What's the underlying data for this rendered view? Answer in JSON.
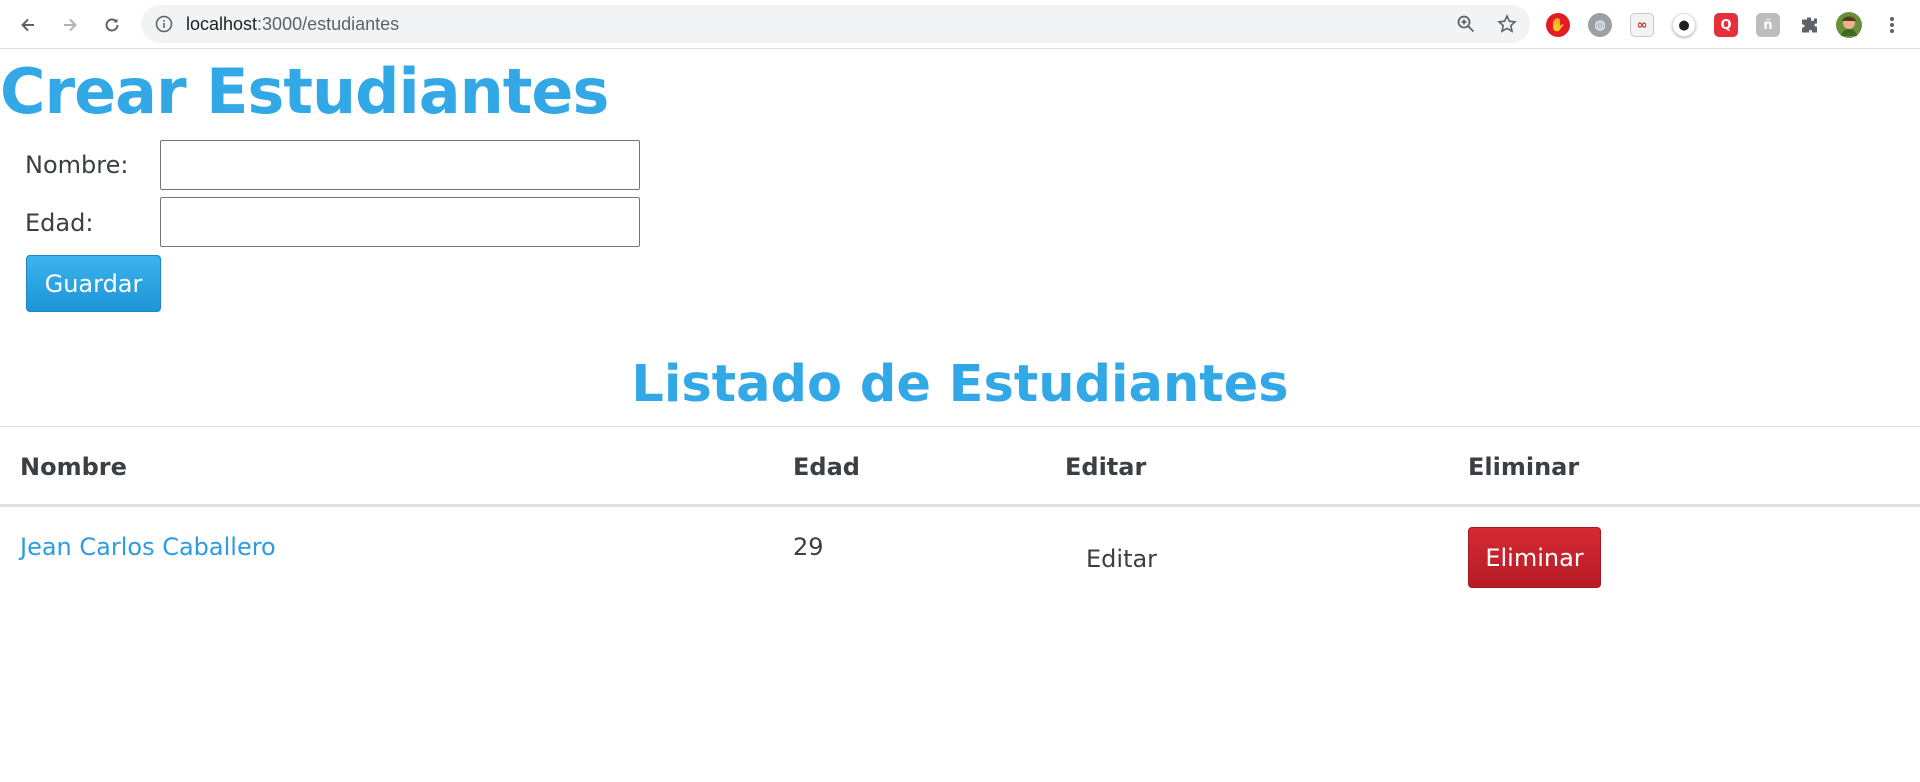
{
  "browser": {
    "url_host": "localhost",
    "url_path": ":3000/estudiantes",
    "icons": [
      "back-icon",
      "forward-icon",
      "reload-icon",
      "site-info-icon",
      "zoom-icon",
      "bookmark-star-icon",
      "extensions-icon",
      "menu-icon"
    ]
  },
  "form": {
    "title": "Crear Estudiantes",
    "name_label": "Nombre:",
    "name_value": "",
    "age_label": "Edad:",
    "age_value": "",
    "save_label": "Guardar"
  },
  "list": {
    "title": "Listado de Estudiantes",
    "columns": [
      "Nombre",
      "Edad",
      "Editar",
      "Eliminar"
    ],
    "rows": [
      {
        "name": "Jean Carlos Caballero",
        "age": "29",
        "edit": "Editar",
        "delete": "Eliminar"
      }
    ]
  },
  "colors": {
    "heading": "#32a8e6",
    "save_button": "#2aa3e4",
    "delete_button": "#c5222b",
    "link": "#2b9de0"
  }
}
